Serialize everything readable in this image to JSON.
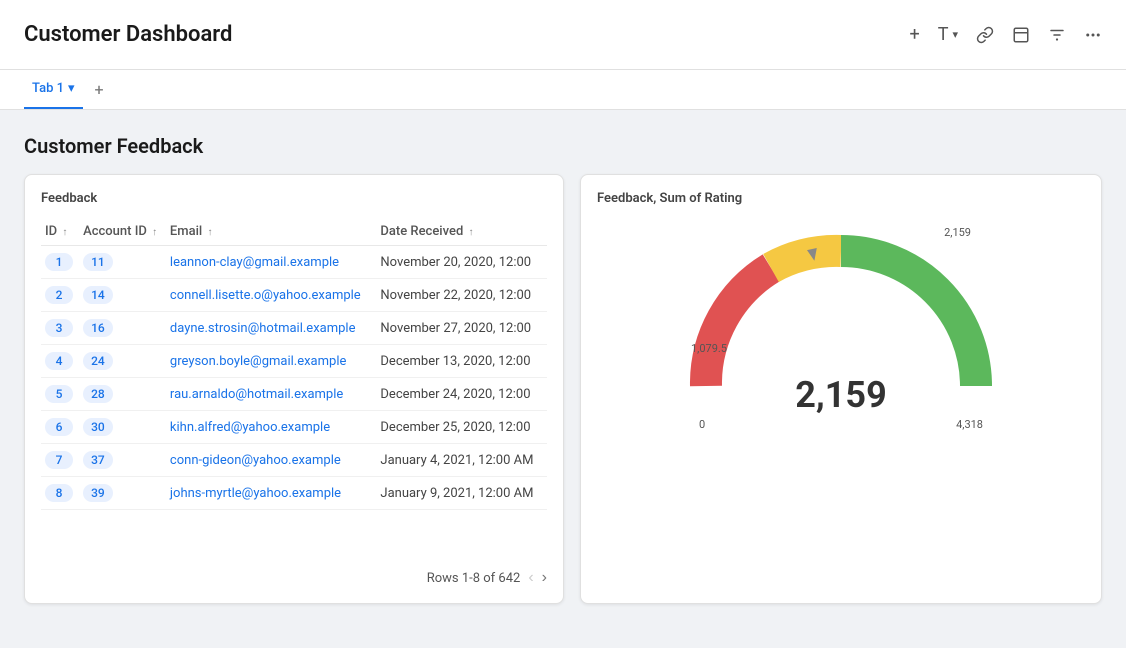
{
  "header": {
    "title": "Customer Dashboard",
    "toolbar": {
      "plus": "+",
      "text": "T",
      "link": "🔗",
      "embed": "▣",
      "filter": "⚌",
      "more": "···"
    }
  },
  "tabs": {
    "active": "Tab 1",
    "chevron": "▾",
    "add": "+"
  },
  "section": {
    "title": "Customer Feedback"
  },
  "feedback_table": {
    "header": "Feedback",
    "columns": [
      "ID",
      "Account ID",
      "Email",
      "Date Received"
    ],
    "rows": [
      {
        "id": "1",
        "account_id": "11",
        "email": "leannon-clay@gmail.example",
        "date": "November 20, 2020, 12:00"
      },
      {
        "id": "2",
        "account_id": "14",
        "email": "connell.lisette.o@yahoo.example",
        "date": "November 22, 2020, 12:00"
      },
      {
        "id": "3",
        "account_id": "16",
        "email": "dayne.strosin@hotmail.example",
        "date": "November 27, 2020, 12:00"
      },
      {
        "id": "4",
        "account_id": "24",
        "email": "greyson.boyle@gmail.example",
        "date": "December 13, 2020, 12:00"
      },
      {
        "id": "5",
        "account_id": "28",
        "email": "rau.arnaldo@hotmail.example",
        "date": "December 24, 2020, 12:00"
      },
      {
        "id": "6",
        "account_id": "30",
        "email": "kihn.alfred@yahoo.example",
        "date": "December 25, 2020, 12:00"
      },
      {
        "id": "7",
        "account_id": "37",
        "email": "conn-gideon@yahoo.example",
        "date": "January 4, 2021, 12:00 AM"
      },
      {
        "id": "8",
        "account_id": "39",
        "email": "johns-myrtle@yahoo.example",
        "date": "January 9, 2021, 12:00 AM"
      }
    ],
    "pagination": {
      "label": "Rows 1-8 of 642"
    }
  },
  "gauge": {
    "header": "Feedback, Sum of Rating",
    "value": "2,159",
    "label_top": "2,159",
    "label_left": "1,079.5",
    "label_bottom_left": "0",
    "label_bottom_right": "4,318",
    "colors": {
      "red": "#e05252",
      "yellow": "#f5c842",
      "green": "#5cb85c"
    }
  }
}
